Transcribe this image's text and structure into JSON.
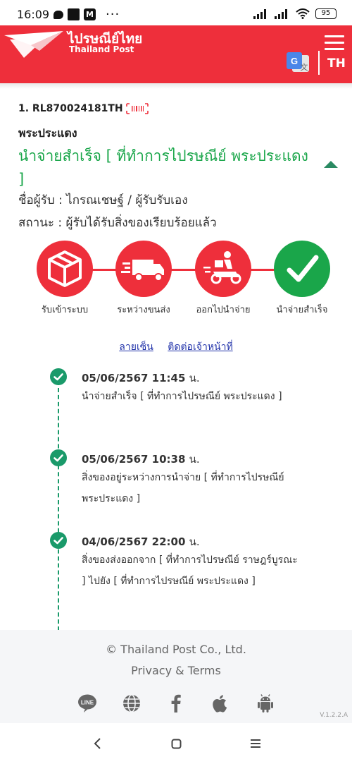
{
  "status_bar": {
    "time": "16:09",
    "dots": "···",
    "battery": "95"
  },
  "header": {
    "brand_th": "ไปรษณีย์ไทย",
    "brand_en": "Thailand Post",
    "language": "TH"
  },
  "tracking": {
    "number": "1. RL870024181TH",
    "office": "พระประแดง",
    "status_title": "นำจ่ายสำเร็จ [ ที่ทำการไปรษณีย์ พระประแดง ]",
    "recipient": "ชื่อผู้รับ : ไกรณเชษฐ์ / ผู้รับรับเอง",
    "state": "สถานะ : ผู้รับได้รับสิ่งของเรียบร้อยแล้ว"
  },
  "steps": [
    {
      "label": "รับเข้าระบบ",
      "icon": "box-icon",
      "done": false
    },
    {
      "label": "ระหว่างขนส่ง",
      "icon": "truck-icon",
      "done": false
    },
    {
      "label": "ออกไปนำจ่าย",
      "icon": "delivery-scooter-icon",
      "done": false
    },
    {
      "label": "นำจ่ายสำเร็จ",
      "icon": "check-icon",
      "done": true
    }
  ],
  "links": {
    "signature": "ลายเซ็น",
    "contact": "ติดต่อเจ้าหน้าที่"
  },
  "timeline": [
    {
      "date": "05/06/2567 11:45",
      "unit": "น.",
      "desc": "นำจ่ายสำเร็จ [ ที่ทำการไปรษณีย์ พระประแดง ]"
    },
    {
      "date": "05/06/2567 10:38",
      "unit": "น.",
      "desc": "สิ่งของอยู่ระหว่างการนำจ่าย [ ที่ทำการไปรษณีย์ พระประแดง ]"
    },
    {
      "date": "04/06/2567 22:00",
      "unit": "น.",
      "desc": "สิ่งของส่งออกจาก [ ที่ทำการไปรษณีย์ ราษฎร์บูรณะ ] ไปยัง [ ที่ทำการไปรษณีย์ พระประแดง ]"
    }
  ],
  "footer": {
    "copyright": "© Thailand Post Co., Ltd.",
    "privacy": "Privacy & Terms",
    "version": "V.1.2.2.A",
    "social": [
      "line-icon",
      "globe-icon",
      "facebook-icon",
      "apple-icon",
      "android-icon"
    ]
  },
  "colors": {
    "brand_red": "#ee2f3b",
    "success_green": "#1aa64a",
    "timeline_green": "#1a9a6a"
  }
}
